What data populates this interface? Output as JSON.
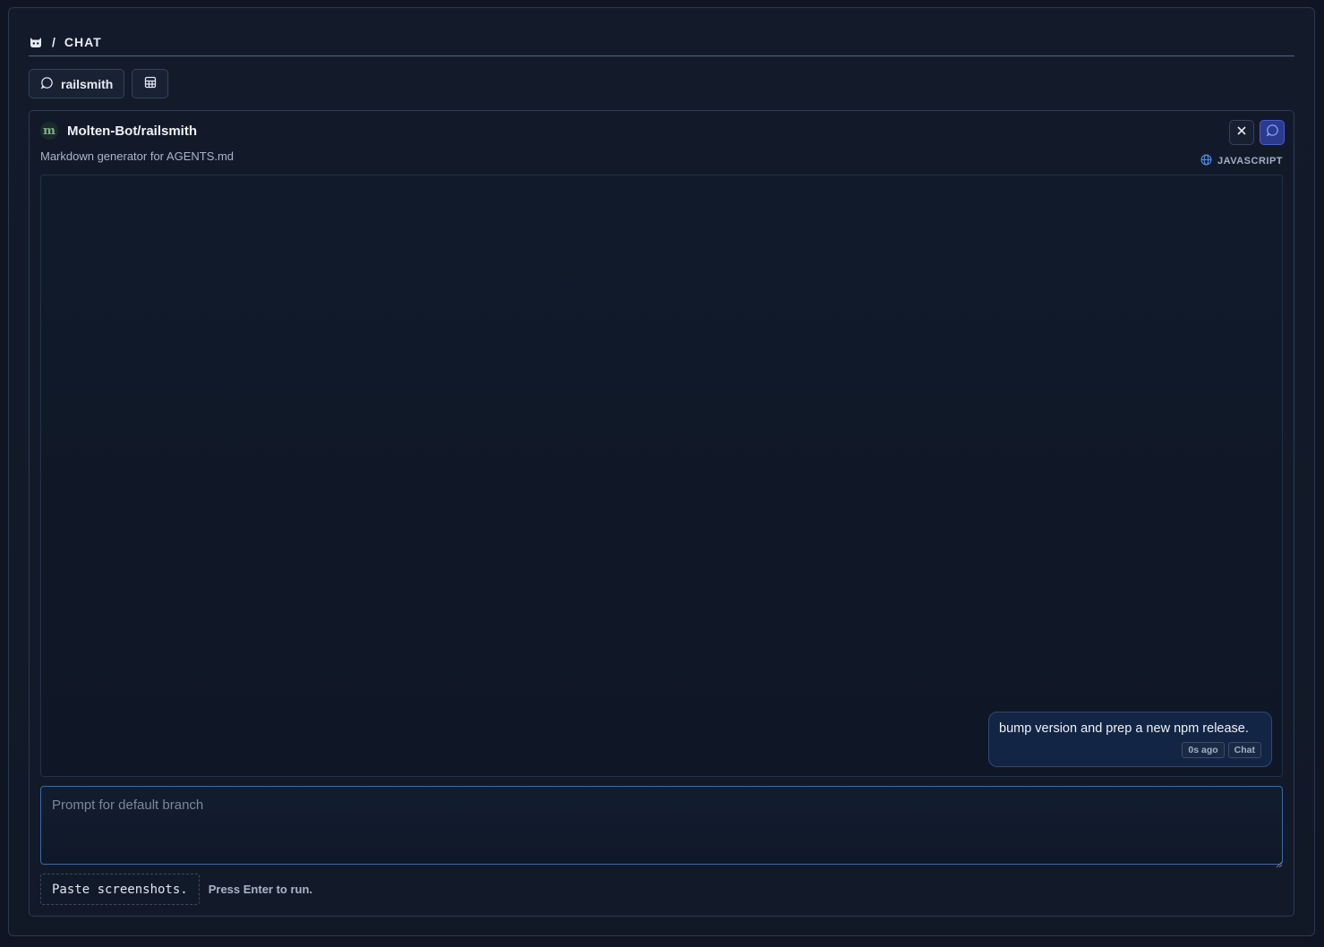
{
  "header": {
    "separator": "/",
    "title": "CHAT"
  },
  "tabs": [
    {
      "label": "railsmith",
      "icon": "chat-bubble-icon"
    },
    {
      "label": "",
      "icon": "grid-icon"
    }
  ],
  "panel": {
    "repo_name": "Molten-Bot/railsmith",
    "avatar_letter": "m",
    "description": "Markdown generator for AGENTS.md",
    "language": "JAVASCRIPT",
    "colors": {
      "accent": "#2b3a8c",
      "bubble": "#132544"
    }
  },
  "messages": [
    {
      "text": "bump version and prep a new npm release.",
      "time": "0s ago",
      "mode": "Chat"
    }
  ],
  "prompt": {
    "placeholder": "Prompt for default branch",
    "value": ""
  },
  "footer": {
    "paste_label": "Paste screenshots.",
    "hint": "Press Enter to run."
  }
}
